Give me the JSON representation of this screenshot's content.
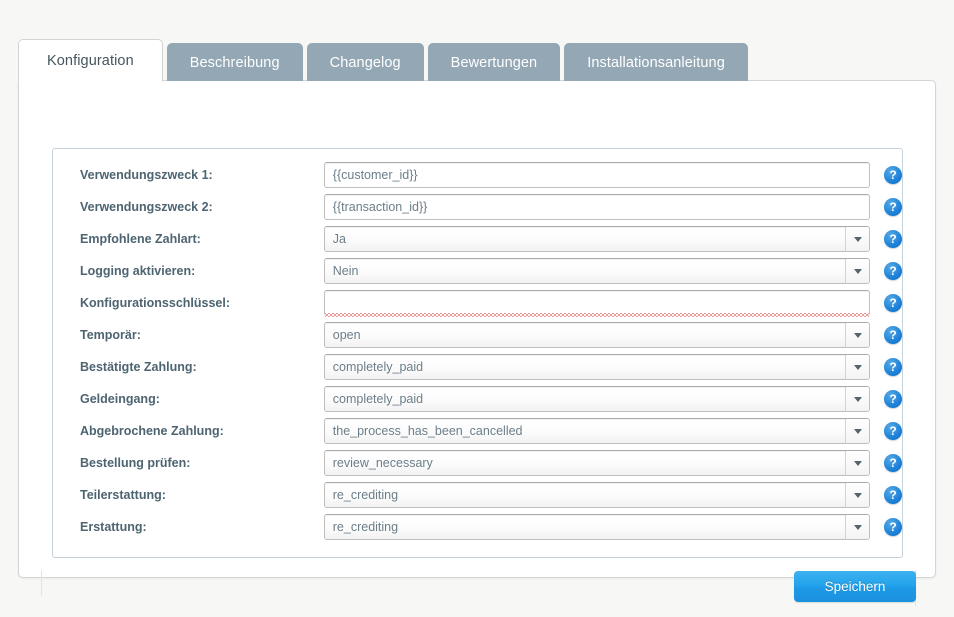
{
  "tabs": [
    {
      "label": "Konfiguration",
      "active": true
    },
    {
      "label": "Beschreibung",
      "active": false
    },
    {
      "label": "Changelog",
      "active": false
    },
    {
      "label": "Bewertungen",
      "active": false
    },
    {
      "label": "Installationsanleitung",
      "active": false
    }
  ],
  "form": {
    "rows": [
      {
        "label": "Verwendungszweck 1:",
        "type": "text",
        "value": "{{customer_id}}",
        "help": "?",
        "error": false
      },
      {
        "label": "Verwendungszweck 2:",
        "type": "text",
        "value": "{{transaction_id}}",
        "help": "?",
        "error": false
      },
      {
        "label": "Empfohlene Zahlart:",
        "type": "select",
        "value": "Ja",
        "help": "?",
        "error": false
      },
      {
        "label": "Logging aktivieren:",
        "type": "select",
        "value": "Nein",
        "help": "?",
        "error": false
      },
      {
        "label": "Konfigurationsschlüssel:",
        "type": "text",
        "value": "",
        "help": "?",
        "error": true
      },
      {
        "label": "Temporär:",
        "type": "select",
        "value": "open",
        "help": "?",
        "error": false
      },
      {
        "label": "Bestätigte Zahlung:",
        "type": "select",
        "value": "completely_paid",
        "help": "?",
        "error": false
      },
      {
        "label": "Geldeingang:",
        "type": "select",
        "value": "completely_paid",
        "help": "?",
        "error": false
      },
      {
        "label": "Abgebrochene Zahlung:",
        "type": "select",
        "value": "the_process_has_been_cancelled",
        "help": "?",
        "error": false
      },
      {
        "label": "Bestellung prüfen:",
        "type": "select",
        "value": "review_necessary",
        "help": "?",
        "error": false
      },
      {
        "label": "Teilerstattung:",
        "type": "select",
        "value": "re_crediting",
        "help": "?",
        "error": false
      },
      {
        "label": "Erstattung:",
        "type": "select",
        "value": "re_crediting",
        "help": "?",
        "error": false
      }
    ]
  },
  "footer": {
    "save_label": "Speichern"
  },
  "colors": {
    "page_background": "#f7f7f5",
    "tab_inactive": "#93a7b4",
    "tab_active_text": "#44555f",
    "label_text": "#4d6471",
    "value_text": "#6b7e8a",
    "panel_border": "#c5d2db",
    "help_icon": "#1a7fd4",
    "save_button": "#23a3ec",
    "error_underline": "#d9302c"
  }
}
